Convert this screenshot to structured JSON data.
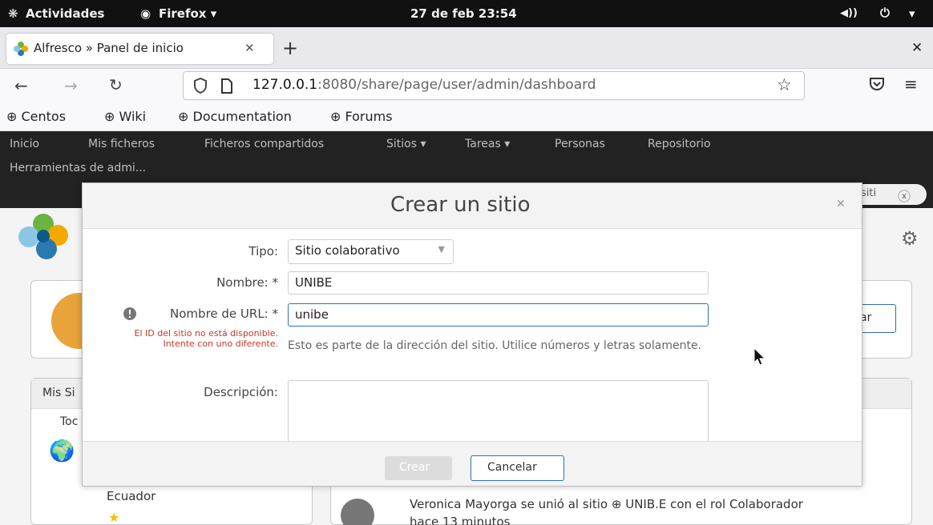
{
  "os": {
    "activities": "Actividades",
    "app": "Firefox",
    "clock": "27 de feb  23:54"
  },
  "browser": {
    "tab_title": "Alfresco » Panel de inicio",
    "url_host": "127.0.0.1",
    "url_rest": ":8080/share/page/user/admin/dashboard",
    "bookmarks": [
      "Centos",
      "Wiki",
      "Documentation",
      "Forums"
    ]
  },
  "alfresco": {
    "menu": [
      "Inicio",
      "Mis ficheros",
      "Ficheros compartidos",
      "Sitios ▾",
      "Tareas ▾",
      "Personas",
      "Repositorio"
    ],
    "menu_admin": "Herramientas de admi...",
    "search_fragment": "siti",
    "bg_button_fragment": "ar",
    "my_sites_fragment": "Mis Si",
    "all_fragment": "Toc",
    "site_name": "Ecuador",
    "activity_text": "Veronica Mayorga se unió al sitio",
    "activity_site": "UNIB.E",
    "activity_role": "con el rol Colaborador",
    "activity_time": "hace 13 minutos"
  },
  "dialog": {
    "title": "Crear un sitio",
    "type_label": "Tipo:",
    "type_value": "Sitio colaborativo",
    "name_label": "Nombre: *",
    "name_value": "UNIBE",
    "url_label": "Nombre de URL: *",
    "url_value": "unibe",
    "error_line1": "El ID del sitio no está disponible.",
    "error_line2": "Intente con uno diferente.",
    "url_help": "Esto es parte de la dirección del sitio. Utilice números y letras solamente.",
    "desc_label": "Descripción:",
    "create_button": "Crear",
    "cancel_button": "Cancelar"
  },
  "colors": {
    "error": "#c0392b",
    "accent": "#2f6fb0",
    "header_dark": "#222222"
  }
}
